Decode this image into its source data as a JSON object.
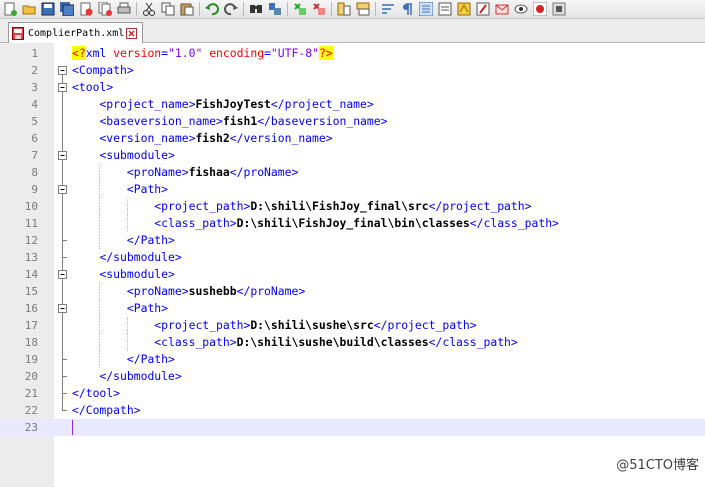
{
  "toolbar": {
    "icons": [
      "new-file-icon",
      "open-file-icon",
      "save-icon",
      "save-all-icon",
      "close-icon",
      "close-all-icon",
      "print-icon",
      "cut-icon",
      "copy-icon",
      "paste-icon",
      "undo-icon",
      "redo-icon",
      "find-icon",
      "replace-icon",
      "zoom-in-icon",
      "zoom-out-icon",
      "sync-vertical-icon",
      "sync-horizontal-icon",
      "word-wrap-icon",
      "show-all-chars-icon",
      "indent-guide-icon",
      "user-lang-icon",
      "doc-map-icon",
      "function-list-icon",
      "folder-workspace-icon",
      "monitor-icon",
      "record-macro-icon",
      "stop-record-icon"
    ]
  },
  "tab": {
    "label": "ComplierPath.xml"
  },
  "editor": {
    "current_line": 23,
    "lines": [
      {
        "n": "1",
        "fold": "none",
        "tokens": [
          {
            "t": "<?",
            "c": "pi"
          },
          {
            "t": "xml ",
            "c": "tag"
          },
          {
            "t": "version",
            "c": "attr"
          },
          {
            "t": "=",
            "c": "tag"
          },
          {
            "t": "\"1.0\"",
            "c": "val"
          },
          {
            "t": " ",
            "c": "tag"
          },
          {
            "t": "encoding",
            "c": "attr"
          },
          {
            "t": "=",
            "c": "tag"
          },
          {
            "t": "\"UTF-8\"",
            "c": "val"
          },
          {
            "t": "?>",
            "c": "pi"
          }
        ]
      },
      {
        "n": "2",
        "fold": "minus",
        "tokens": [
          {
            "t": "<Compath>",
            "c": "tag"
          }
        ]
      },
      {
        "n": "3",
        "fold": "minus",
        "tokens": [
          {
            "t": "<tool>",
            "c": "tag"
          }
        ]
      },
      {
        "n": "4",
        "fold": "line",
        "tokens": [
          {
            "t": "    ",
            "c": "txtv"
          },
          {
            "t": "<project_name>",
            "c": "tag"
          },
          {
            "t": "FishJoyTest",
            "c": "txtv"
          },
          {
            "t": "</project_name>",
            "c": "tag"
          }
        ]
      },
      {
        "n": "5",
        "fold": "line",
        "tokens": [
          {
            "t": "    ",
            "c": "txtv"
          },
          {
            "t": "<baseversion_name>",
            "c": "tag"
          },
          {
            "t": "fish1",
            "c": "txtv"
          },
          {
            "t": "</baseversion_name>",
            "c": "tag"
          }
        ]
      },
      {
        "n": "6",
        "fold": "line",
        "tokens": [
          {
            "t": "    ",
            "c": "txtv"
          },
          {
            "t": "<version_name>",
            "c": "tag"
          },
          {
            "t": "fish2",
            "c": "txtv"
          },
          {
            "t": "</version_name>",
            "c": "tag"
          }
        ]
      },
      {
        "n": "7",
        "fold": "minus",
        "tokens": [
          {
            "t": "    ",
            "c": "txtv"
          },
          {
            "t": "<submodule>",
            "c": "tag"
          }
        ]
      },
      {
        "n": "8",
        "fold": "line",
        "tokens": [
          {
            "t": "        ",
            "c": "txtv"
          },
          {
            "t": "<proName>",
            "c": "tag"
          },
          {
            "t": "fishaa",
            "c": "txtv"
          },
          {
            "t": "</proName>",
            "c": "tag"
          }
        ]
      },
      {
        "n": "9",
        "fold": "minus",
        "tokens": [
          {
            "t": "        ",
            "c": "txtv"
          },
          {
            "t": "<Path>",
            "c": "tag"
          }
        ]
      },
      {
        "n": "10",
        "fold": "line",
        "tokens": [
          {
            "t": "            ",
            "c": "txtv"
          },
          {
            "t": "<project_path>",
            "c": "tag"
          },
          {
            "t": "D:\\shili\\FishJoy_final\\src",
            "c": "txtv"
          },
          {
            "t": "</project_path>",
            "c": "tag"
          }
        ]
      },
      {
        "n": "11",
        "fold": "line",
        "tokens": [
          {
            "t": "            ",
            "c": "txtv"
          },
          {
            "t": "<class_path>",
            "c": "tag"
          },
          {
            "t": "D:\\shili\\FishJoy_final\\bin\\classes",
            "c": "txtv"
          },
          {
            "t": "</class_path>",
            "c": "tag"
          }
        ]
      },
      {
        "n": "12",
        "fold": "end",
        "tokens": [
          {
            "t": "        ",
            "c": "txtv"
          },
          {
            "t": "</Path>",
            "c": "tag"
          }
        ]
      },
      {
        "n": "13",
        "fold": "end",
        "tokens": [
          {
            "t": "    ",
            "c": "txtv"
          },
          {
            "t": "</submodule>",
            "c": "tag"
          }
        ]
      },
      {
        "n": "14",
        "fold": "minus",
        "tokens": [
          {
            "t": "    ",
            "c": "txtv"
          },
          {
            "t": "<submodule>",
            "c": "tag"
          }
        ]
      },
      {
        "n": "15",
        "fold": "line",
        "tokens": [
          {
            "t": "        ",
            "c": "txtv"
          },
          {
            "t": "<proName>",
            "c": "tag"
          },
          {
            "t": "sushebb",
            "c": "txtv"
          },
          {
            "t": "</proName>",
            "c": "tag"
          }
        ]
      },
      {
        "n": "16",
        "fold": "minus",
        "tokens": [
          {
            "t": "        ",
            "c": "txtv"
          },
          {
            "t": "<Path>",
            "c": "tag"
          }
        ]
      },
      {
        "n": "17",
        "fold": "line",
        "tokens": [
          {
            "t": "            ",
            "c": "txtv"
          },
          {
            "t": "<project_path>",
            "c": "tag"
          },
          {
            "t": "D:\\shili\\sushe\\src",
            "c": "txtv"
          },
          {
            "t": "</project_path>",
            "c": "tag"
          }
        ]
      },
      {
        "n": "18",
        "fold": "line",
        "tokens": [
          {
            "t": "            ",
            "c": "txtv"
          },
          {
            "t": "<class_path>",
            "c": "tag"
          },
          {
            "t": "D:\\shili\\sushe\\build\\classes",
            "c": "txtv"
          },
          {
            "t": "</class_path>",
            "c": "tag"
          }
        ]
      },
      {
        "n": "19",
        "fold": "end",
        "tokens": [
          {
            "t": "        ",
            "c": "txtv"
          },
          {
            "t": "</Path>",
            "c": "tag"
          }
        ]
      },
      {
        "n": "20",
        "fold": "end",
        "tokens": [
          {
            "t": "    ",
            "c": "txtv"
          },
          {
            "t": "</submodule>",
            "c": "tag"
          }
        ]
      },
      {
        "n": "21",
        "fold": "end",
        "tokens": [
          {
            "t": "</tool>",
            "c": "tag"
          }
        ]
      },
      {
        "n": "22",
        "fold": "end",
        "tokens": [
          {
            "t": "</Compath>",
            "c": "tag"
          }
        ]
      },
      {
        "n": "23",
        "fold": "none",
        "tokens": []
      }
    ]
  },
  "watermark": "@51CTO博客"
}
